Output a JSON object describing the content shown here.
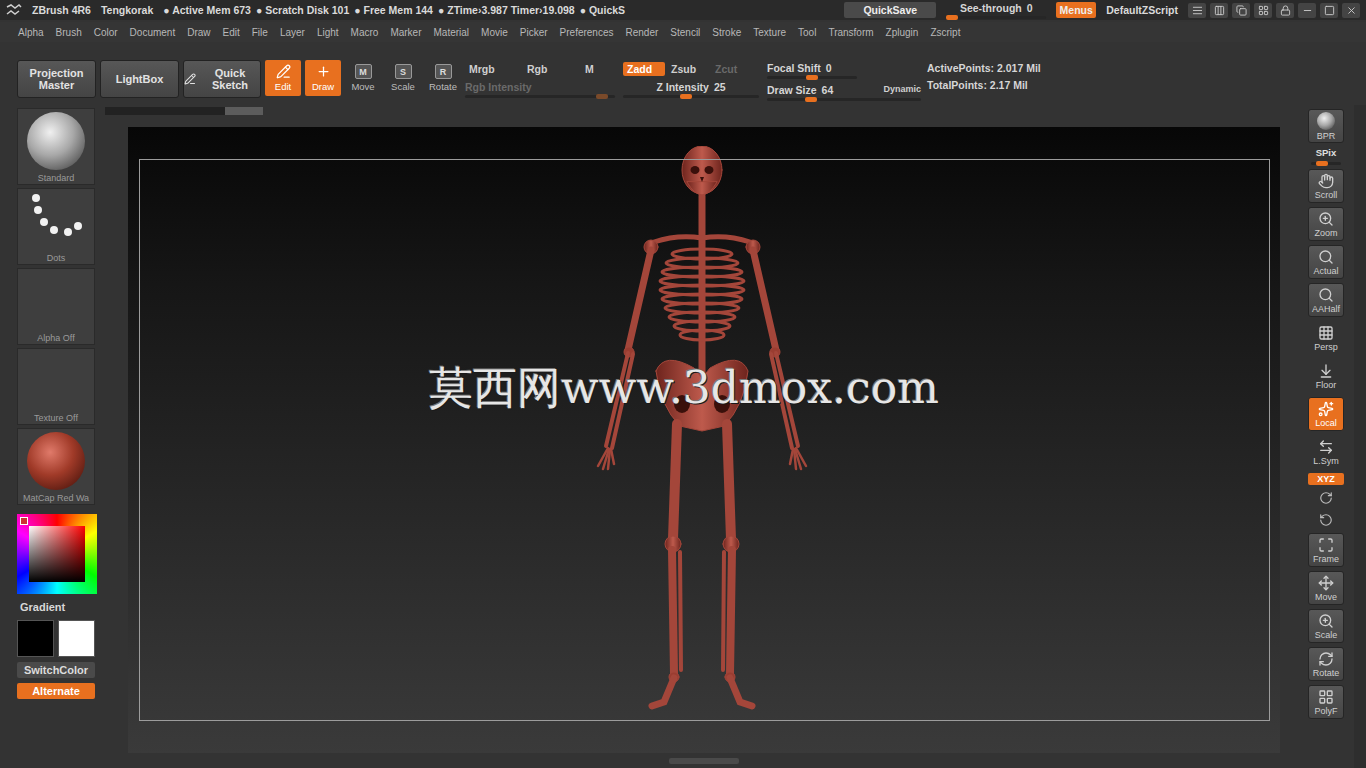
{
  "title_bar": {
    "app": "ZBrush 4R6",
    "document": "Tengkorak",
    "stats": [
      "● Active Mem 673",
      "● Scratch Disk 101",
      "● Free Mem 144",
      "● ZTime›3.987 Timer›19.098",
      "● QuickS"
    ],
    "quicksave": "QuickSave",
    "see_through": {
      "label": "See-through",
      "value": "0",
      "level": 0
    },
    "menus": {
      "label": "Menus",
      "on": true
    },
    "script": "DefaultZScript"
  },
  "menu_bar": [
    "Alpha",
    "Brush",
    "Color",
    "Document",
    "Draw",
    "Edit",
    "File",
    "Layer",
    "Light",
    "Macro",
    "Marker",
    "Material",
    "Movie",
    "Picker",
    "Preferences",
    "Render",
    "Stencil",
    "Stroke",
    "Texture",
    "Tool",
    "Transform",
    "Zplugin",
    "Zscript"
  ],
  "top_shelf": {
    "panels": [
      "Projection Master",
      "LightBox"
    ],
    "quick_sketch": "Quick Sketch",
    "transform_tools": [
      {
        "label": "Edit",
        "selected": true
      },
      {
        "label": "Draw",
        "selected": true
      },
      {
        "label": "Move",
        "key": "M",
        "selected": false
      },
      {
        "label": "Scale",
        "key": "S",
        "selected": false
      },
      {
        "label": "Rotate",
        "key": "R",
        "selected": false
      }
    ],
    "color_modes": [
      {
        "label": "Mrgb",
        "selected": false
      },
      {
        "label": "Rgb",
        "selected": false
      },
      {
        "label": "M",
        "selected": false
      }
    ],
    "rgb_intensity": {
      "label": "Rgb Intensity",
      "disabled": true,
      "level": 0.95
    },
    "z_modes": [
      {
        "label": "Zadd",
        "selected": true,
        "disabled": false
      },
      {
        "label": "Zsub",
        "selected": false,
        "disabled": false
      },
      {
        "label": "Zcut",
        "selected": false,
        "disabled": true
      }
    ],
    "z_intensity": {
      "label": "Z Intensity",
      "value": "25",
      "level": 0.46
    },
    "focal_shift": {
      "label": "Focal Shift",
      "value": "0",
      "level": 0.5
    },
    "draw_size": {
      "label": "Draw Size",
      "value": "64",
      "level": 0.27,
      "dynamic": "Dynamic"
    },
    "points": [
      "ActivePoints: 2.017 Mil",
      "TotalPoints: 2.17 Mil"
    ]
  },
  "left_shelf": {
    "tiles": [
      {
        "label": "Standard",
        "kind": "brush"
      },
      {
        "label": "Dots",
        "kind": "stroke"
      },
      {
        "label": "Alpha Off",
        "kind": "empty"
      },
      {
        "label": "Texture Off",
        "kind": "empty"
      },
      {
        "label": "MatCap Red Wa",
        "kind": "material"
      }
    ],
    "gradient": "Gradient",
    "swatches": [
      {
        "color": "#000000"
      },
      {
        "color": "#ffffff"
      }
    ],
    "switch_color": "SwitchColor",
    "alternate": {
      "label": "Alternate",
      "on": true
    }
  },
  "canvas": {
    "watermark": "莫西网www.3dmox.com"
  },
  "right_shelf": [
    {
      "label": "BPR",
      "kind": "button",
      "on": false
    },
    {
      "label": "SPix",
      "kind": "slider",
      "level": 0.3
    },
    {
      "label": "Scroll",
      "kind": "button",
      "on": false
    },
    {
      "label": "Zoom",
      "kind": "button",
      "on": false
    },
    {
      "label": "Actual",
      "kind": "button",
      "on": false
    },
    {
      "label": "AAHalf",
      "kind": "button",
      "on": false
    },
    {
      "label": "Persp",
      "kind": "flat",
      "on": false
    },
    {
      "label": "Floor",
      "kind": "flat",
      "on": false
    },
    {
      "label": "Local",
      "kind": "button",
      "on": true
    },
    {
      "label": "L.Sym",
      "kind": "flat",
      "on": false
    },
    {
      "label": "XYZ",
      "kind": "pill",
      "on": true
    },
    {
      "kind": "icon",
      "on": false
    },
    {
      "kind": "icon",
      "on": false
    },
    {
      "label": "Frame",
      "kind": "button",
      "on": false
    },
    {
      "label": "Move",
      "kind": "button",
      "on": false
    },
    {
      "label": "Scale",
      "kind": "button",
      "on": false
    },
    {
      "label": "Rotate",
      "kind": "button",
      "on": false
    },
    {
      "label": "PolyF",
      "kind": "button",
      "on": false
    }
  ]
}
